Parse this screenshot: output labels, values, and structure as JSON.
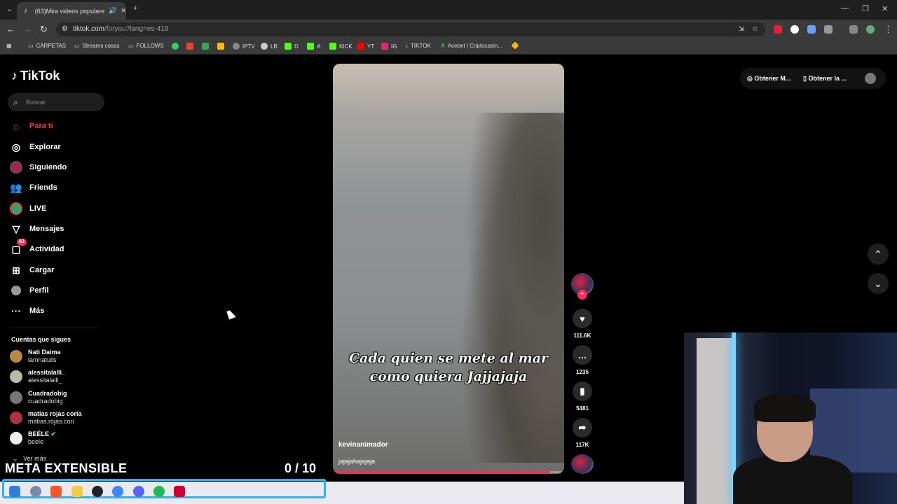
{
  "browser": {
    "tab_title": "(63)Mira videos populares s",
    "url_host": "tiktok.com",
    "url_path": "/foryou?lang=es-419",
    "bookmarks": [
      {
        "label": "CARPETAS"
      },
      {
        "label": "Streams cosas"
      },
      {
        "label": "FOLLOWS"
      },
      {
        "label": ""
      },
      {
        "label": ""
      },
      {
        "label": ""
      },
      {
        "label": ""
      },
      {
        "label": "IPTV"
      },
      {
        "label": "LB"
      },
      {
        "label": "D"
      },
      {
        "label": "A"
      },
      {
        "label": "KICK"
      },
      {
        "label": "YT"
      },
      {
        "label": "IG"
      },
      {
        "label": "TIKTOK"
      },
      {
        "label": "Acebet | Criptocasin..."
      }
    ]
  },
  "sidebar": {
    "logo": "TikTok",
    "search_placeholder": "Buscar",
    "nav": [
      {
        "label": "Para ti",
        "icon": "home-icon"
      },
      {
        "label": "Explorar",
        "icon": "compass-icon"
      },
      {
        "label": "Siguiendo",
        "icon": "following-avatar-icon"
      },
      {
        "label": "Friends",
        "icon": "friends-icon"
      },
      {
        "label": "LIVE",
        "icon": "live-icon"
      },
      {
        "label": "Mensajes",
        "icon": "message-icon"
      },
      {
        "label": "Actividad",
        "icon": "activity-icon",
        "badge": "63"
      },
      {
        "label": "Cargar",
        "icon": "upload-icon"
      },
      {
        "label": "Perfil",
        "icon": "profile-icon"
      },
      {
        "label": "Más",
        "icon": "more-icon"
      }
    ],
    "following_header": "Cuentas que sigues",
    "accounts": [
      {
        "name": "Nati Daima",
        "handle": "iamnatulis"
      },
      {
        "name": "alessitalalli_",
        "handle": "alessitalalli_"
      },
      {
        "name": "Cuadradobig",
        "handle": "cuadradobig"
      },
      {
        "name": "matias rojas coria",
        "handle": "matias.rojas.cori"
      },
      {
        "name": "BEÉLE",
        "handle": "beele"
      }
    ],
    "see_more": "Ver más"
  },
  "overlay": {
    "meta_label": "META EXTENSIBLE",
    "meta_count": "0  / 10"
  },
  "video": {
    "caption_line1": "Cada quien se mete al mar",
    "caption_line2": "como quiera Jajjajaja",
    "author": "kevinanimador",
    "description": "jajajahajajaja",
    "progress": 0.94
  },
  "actions": {
    "likes": "111.6K",
    "comments": "1235",
    "saves": "5481",
    "shares": "117K"
  },
  "top_right": {
    "btn1": "Obtener M...",
    "btn2": "Obtener la ..."
  },
  "colors": {
    "accent": "#fe2c55",
    "taskbar_frame": "#1fb4ff"
  }
}
